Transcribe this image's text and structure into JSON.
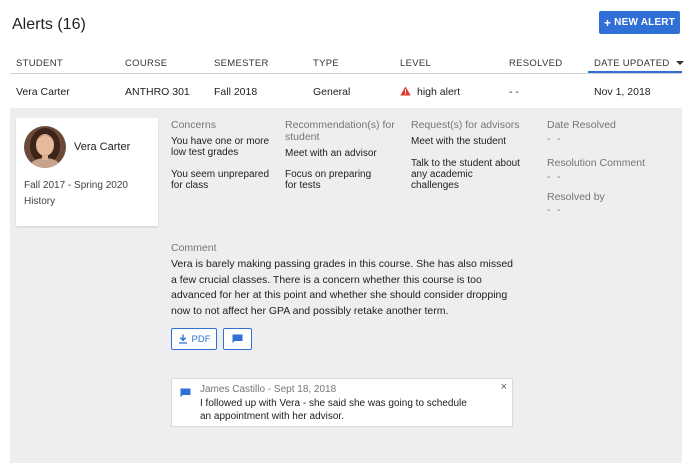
{
  "page": {
    "title": "Alerts (16)",
    "new_alert_label": "NEW ALERT"
  },
  "table": {
    "columns": [
      "STUDENT",
      "COURSE",
      "SEMESTER",
      "TYPE",
      "LEVEL",
      "RESOLVED",
      "DATE UPDATED"
    ],
    "sorted_column": "DATE UPDATED",
    "row": {
      "student": "Vera Carter",
      "course": "ANTHRO 301",
      "semester": "Fall 2018",
      "type": "General",
      "level": "high alert",
      "resolved": "- -",
      "date_updated": "Nov 1, 2018"
    }
  },
  "detail": {
    "card": {
      "name": "Vera Carter",
      "years": "Fall 2017 - Spring 2020",
      "major": "History"
    },
    "concerns": {
      "label": "Concerns",
      "items": [
        "You have one or more low test grades",
        "You seem unprepared for class"
      ]
    },
    "recommendations": {
      "label": "Recommendation(s) for student",
      "items": [
        "Meet with an advisor",
        "Focus on preparing for tests"
      ]
    },
    "requests": {
      "label": "Request(s) for advisors",
      "items": [
        "Meet with the student",
        "Talk to the student about any academic challenges"
      ]
    },
    "date_resolved": {
      "label": "Date Resolved",
      "value": "- -"
    },
    "resolution_comment": {
      "label": "Resolution Comment",
      "value": "- -"
    },
    "resolved_by": {
      "label": "Resolved by",
      "value": "- -"
    },
    "comment": {
      "label": "Comment",
      "text": "Vera is barely making passing grades in this course. She has also missed a few crucial classes. There is a concern whether this course is too advanced for her at this point and whether she should consider dropping now to not affect her GPA and possibly retake another term."
    },
    "pdf_label": "PDF",
    "note": {
      "author_date": "James Castillo - Sept 18, 2018",
      "text": "I followed up with Vera - she said she was going to schedule an appointment with her advisor."
    }
  },
  "colors": {
    "accent": "#2f6fd6",
    "alert": "#e53935",
    "panel": "#eeeef0"
  },
  "icons": [
    "plus-icon",
    "warning-icon",
    "download-icon",
    "message-icon",
    "close-icon",
    "avatar"
  ]
}
